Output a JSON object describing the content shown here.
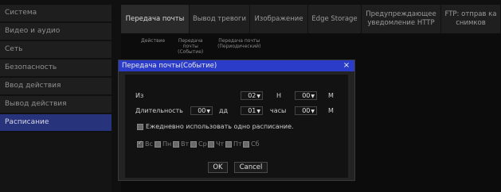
{
  "sidebar": {
    "items": [
      {
        "label": "Система"
      },
      {
        "label": "Видео и аудио"
      },
      {
        "label": "Сеть"
      },
      {
        "label": "Безопасность"
      },
      {
        "label": "Ввод действия"
      },
      {
        "label": "Вывод действия"
      },
      {
        "label": "Расписание",
        "active": true
      }
    ]
  },
  "tabs": [
    {
      "label": "Передача почты",
      "active": true
    },
    {
      "label": "Вывод тревоги"
    },
    {
      "label": "Изображение"
    },
    {
      "label": "Edge Storage"
    },
    {
      "label": "Предупреждающее уведомление HTTP"
    },
    {
      "label": "FTP: отправ ка снимков"
    }
  ],
  "grid": {
    "col_action": "Действие",
    "col_event": "Передача почты (Событие)",
    "col_periodic": "Передача почты (Периодический)"
  },
  "dialog": {
    "title": "Передача почты(Событие)",
    "close_glyph": "×",
    "from_label": "Из",
    "hour_value": "02",
    "hour_unit": "Н",
    "minute_value": "00",
    "minute_unit": "М",
    "duration_label": "Длительность",
    "days_value": "00",
    "days_unit": "дд",
    "dur_hours_value": "01",
    "dur_hours_unit": "часы",
    "dur_minutes_value": "00",
    "dur_minutes_unit": "М",
    "daily_label": "Ежедневно использовать одно расписание.",
    "days": [
      {
        "label": "Вс",
        "checked": true
      },
      {
        "label": "Пн"
      },
      {
        "label": "Вт"
      },
      {
        "label": "Ср"
      },
      {
        "label": "Чт"
      },
      {
        "label": "Пт"
      },
      {
        "label": "Сб"
      }
    ],
    "ok_label": "OK",
    "cancel_label": "Cancel",
    "dropdown_arrow": "▼"
  }
}
